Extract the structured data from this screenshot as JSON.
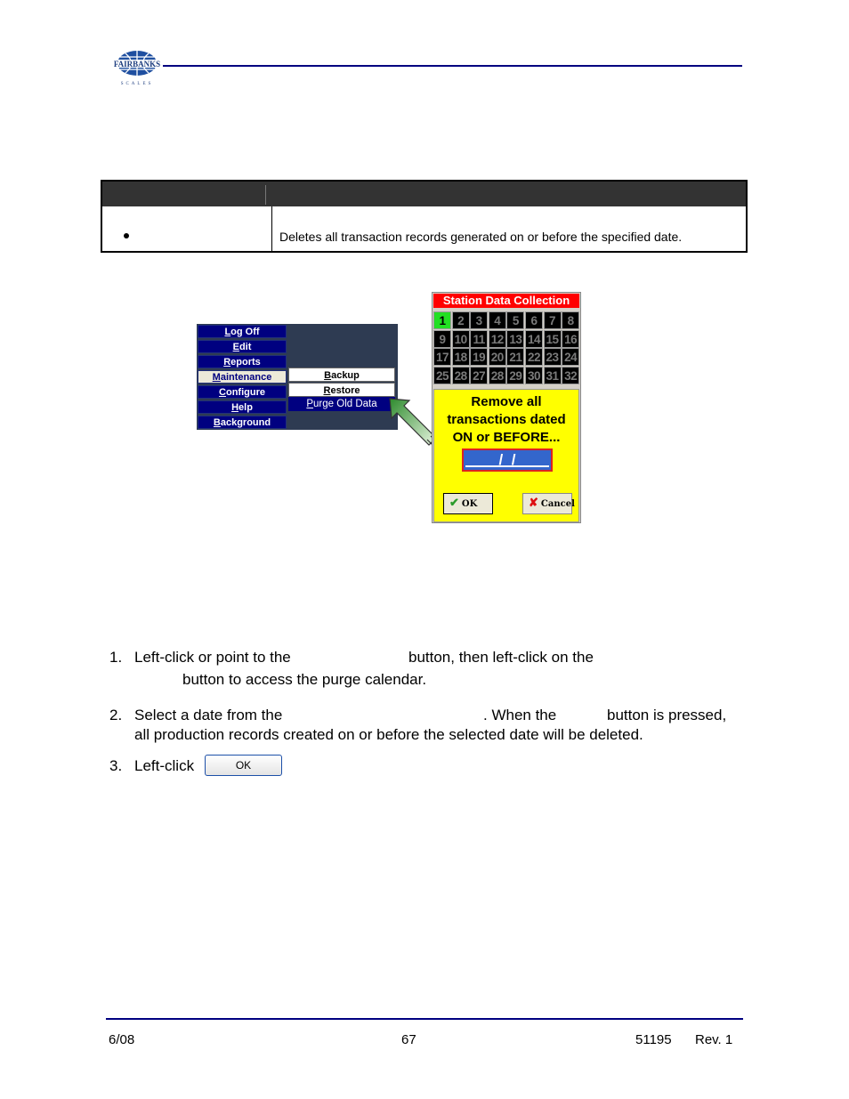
{
  "header": {
    "logo_text": "FAIRBANKS",
    "logo_subtext": "SCALES"
  },
  "table": {
    "headers": [
      "",
      ""
    ],
    "rows": [
      {
        "bullet": "•",
        "description": "Deletes all transaction records generated on or before the specified date."
      }
    ]
  },
  "menu_screenshot": {
    "main_items": [
      {
        "label": "Log Off",
        "accel": "L",
        "rest": "og Off",
        "active": false
      },
      {
        "label": "Edit",
        "accel": "E",
        "rest": "dit",
        "active": false
      },
      {
        "label": "Reports",
        "accel": "R",
        "rest": "eports",
        "active": false
      },
      {
        "label": "Maintenance",
        "accel": "M",
        "rest": "aintenance",
        "active": true
      },
      {
        "label": "Configure",
        "accel": "C",
        "rest": "onfigure",
        "active": false
      },
      {
        "label": "Help",
        "accel": "H",
        "rest": "elp",
        "active": false
      },
      {
        "label": "Background",
        "accel": "B",
        "rest": "ackground",
        "active": false
      }
    ],
    "submenu_items": [
      {
        "label": "Backup",
        "accel": "B",
        "rest": "ackup"
      },
      {
        "label": "Restore",
        "accel": "R",
        "rest": "estore"
      },
      {
        "label": "Purge Old Data",
        "accel": "P",
        "rest": "urge Old Data"
      }
    ]
  },
  "station_panel": {
    "title": "Station Data Collection",
    "selected": "1",
    "cells": [
      "1",
      "2",
      "3",
      "4",
      "5",
      "6",
      "7",
      "8",
      "9",
      "10",
      "11",
      "12",
      "13",
      "14",
      "15",
      "16",
      "17",
      "18",
      "19",
      "20",
      "21",
      "22",
      "23",
      "24",
      "25",
      "28",
      "27",
      "28",
      "29",
      "30",
      "31",
      "32"
    ],
    "message": [
      "Remove all",
      "transactions dated",
      "ON or BEFORE..."
    ],
    "date_value": "/  /",
    "ok_label": "OK",
    "cancel_label": "Cancel",
    "colors": {
      "title_bg": "#ff0000",
      "selected_bg": "#22e022",
      "panel_bg": "#ffff00",
      "date_bg": "#3366cc"
    }
  },
  "steps": [
    {
      "num": "1.",
      "parts": [
        "Left-click or point to the",
        "button, then left-click on the",
        "button to access the purge calendar."
      ]
    },
    {
      "num": "2.",
      "parts": [
        "Select a date from the",
        ".  When the",
        "button is pressed,",
        "all production records created on or before the selected date will be deleted."
      ]
    },
    {
      "num": "3.",
      "parts": [
        "Left-click"
      ],
      "button_label": "OK"
    }
  ],
  "footer": {
    "date": "6/08",
    "page": "67",
    "doc_number": "51195",
    "revision": "Rev. 1"
  }
}
